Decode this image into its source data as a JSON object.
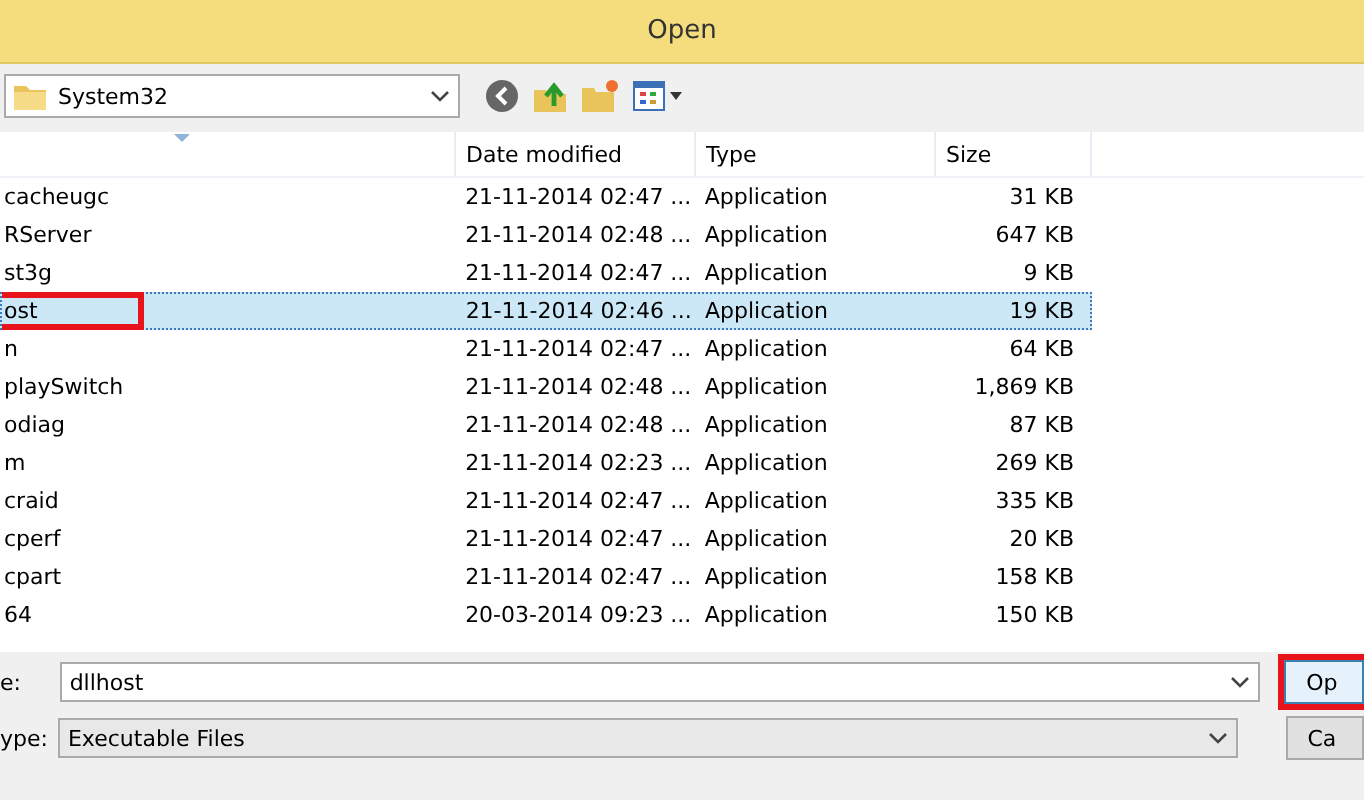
{
  "window": {
    "title": "Open"
  },
  "location": {
    "value": "System32"
  },
  "table": {
    "columns": [
      "Date modified",
      "Type",
      "Size"
    ],
    "rows": [
      {
        "name": "cacheugc",
        "date": "21-11-2014 02:47 ...",
        "type": "Application",
        "size": "31 KB",
        "selected": false,
        "highlighted": false
      },
      {
        "name": "RServer",
        "date": "21-11-2014 02:48 ...",
        "type": "Application",
        "size": "647 KB",
        "selected": false,
        "highlighted": false
      },
      {
        "name": "st3g",
        "date": "21-11-2014 02:47 ...",
        "type": "Application",
        "size": "9 KB",
        "selected": false,
        "highlighted": false
      },
      {
        "name": "ost",
        "date": "21-11-2014 02:46 ...",
        "type": "Application",
        "size": "19 KB",
        "selected": true,
        "highlighted": true
      },
      {
        "name": "n",
        "date": "21-11-2014 02:47 ...",
        "type": "Application",
        "size": "64 KB",
        "selected": false,
        "highlighted": false
      },
      {
        "name": "playSwitch",
        "date": "21-11-2014 02:48 ...",
        "type": "Application",
        "size": "1,869 KB",
        "selected": false,
        "highlighted": false
      },
      {
        "name": "odiag",
        "date": "21-11-2014 02:48 ...",
        "type": "Application",
        "size": "87 KB",
        "selected": false,
        "highlighted": false
      },
      {
        "name": "m",
        "date": "21-11-2014 02:23 ...",
        "type": "Application",
        "size": "269 KB",
        "selected": false,
        "highlighted": false
      },
      {
        "name": "craid",
        "date": "21-11-2014 02:47 ...",
        "type": "Application",
        "size": "335 KB",
        "selected": false,
        "highlighted": false
      },
      {
        "name": "cperf",
        "date": "21-11-2014 02:47 ...",
        "type": "Application",
        "size": "20 KB",
        "selected": false,
        "highlighted": false
      },
      {
        "name": "cpart",
        "date": "21-11-2014 02:47 ...",
        "type": "Application",
        "size": "158 KB",
        "selected": false,
        "highlighted": false
      },
      {
        "name": "64",
        "date": "20-03-2014 09:23 ...",
        "type": "Application",
        "size": "150 KB",
        "selected": false,
        "highlighted": false
      }
    ]
  },
  "file_name": {
    "label": "e:",
    "value": "dllhost"
  },
  "file_type": {
    "label": "ype:",
    "value": "Executable Files"
  },
  "buttons": [
    {
      "label": "Op",
      "highlighted": true
    },
    {
      "label": "Ca",
      "highlighted": false
    }
  ]
}
